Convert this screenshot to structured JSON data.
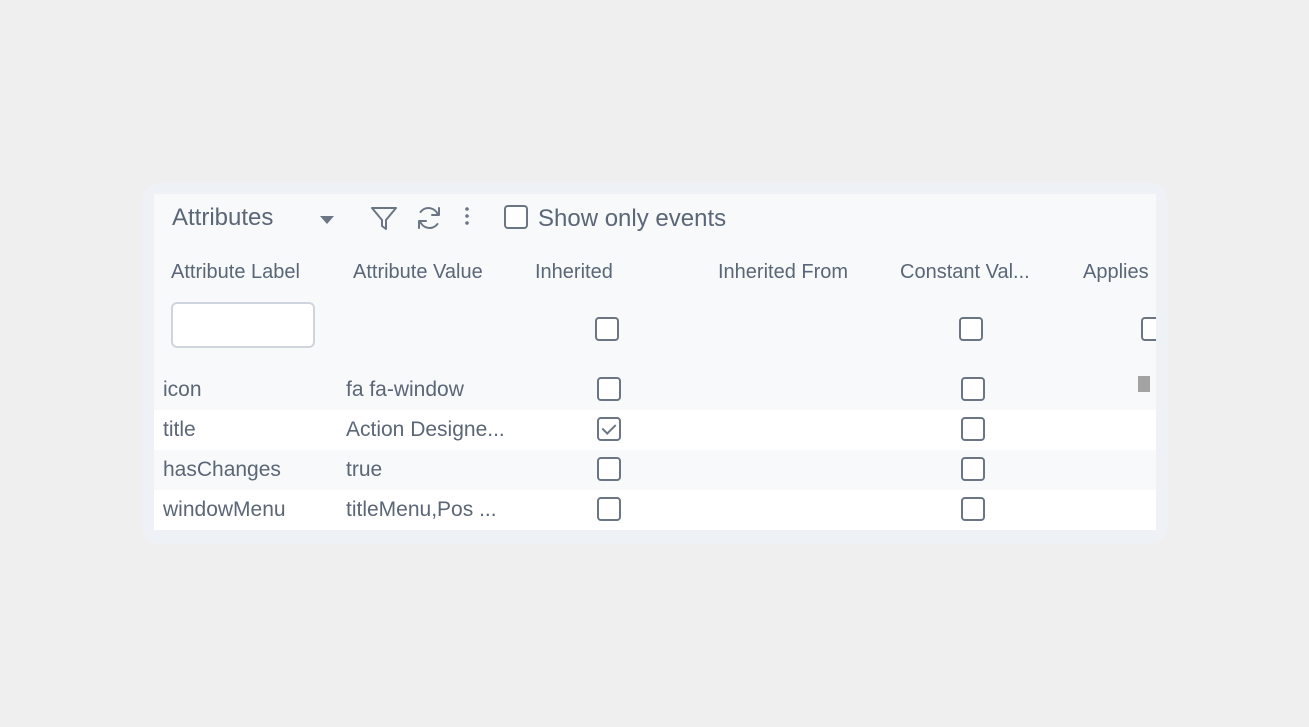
{
  "toolbar": {
    "view_select": "Attributes",
    "filter_icon": "filter-icon",
    "refresh_icon": "refresh-icon",
    "more_icon": "more-vertical-icon",
    "show_only_events_label": "Show only events",
    "show_only_events_checked": false
  },
  "columns": [
    "Attribute Label",
    "Attribute Value",
    "Inherited",
    "Inherited From",
    "Constant Val...",
    "Applies"
  ],
  "filter": {
    "label_value": "",
    "inherited_checked": false,
    "constant_checked": false
  },
  "rows": [
    {
      "label": "icon",
      "value": "fa fa-window",
      "inherited": false,
      "constant": false
    },
    {
      "label": "title",
      "value": "Action Designe...",
      "inherited": true,
      "constant": false
    },
    {
      "label": "hasChanges",
      "value": "true",
      "inherited": false,
      "constant": false
    },
    {
      "label": "windowMenu",
      "value": "titleMenu,Pos  ...",
      "inherited": false,
      "constant": false
    }
  ],
  "colors": {
    "page_bg": "#efefef",
    "panel_bg": "#eef2f7",
    "grid_bg": "#f7f9fb",
    "alt_row_bg": "#ffffff",
    "text": "#5b6676"
  }
}
